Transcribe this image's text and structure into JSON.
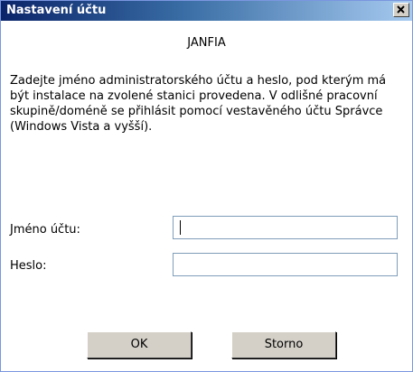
{
  "window": {
    "title": "Nastavení účtu",
    "close_icon": "close-icon"
  },
  "content": {
    "client_name": "JANFIA",
    "description": "Zadejte jméno administratorského účtu a heslo, pod kterým má být instalace na zvolené stanici provedena. V odlišné pracovní skupině/doméně se přihlásit pomocí vestavěného účtu Správce (Windows Vista a vyšší).",
    "username_label": "Jméno účtu:",
    "username_value": "",
    "password_label": "Heslo:",
    "password_value": ""
  },
  "buttons": {
    "ok_label": "OK",
    "cancel_label": "Storno"
  },
  "colors": {
    "titlebar_start": "#0a246a",
    "titlebar_end": "#a6caf0",
    "button_face": "#d4d0c8",
    "field_border": "#7f9db9"
  }
}
